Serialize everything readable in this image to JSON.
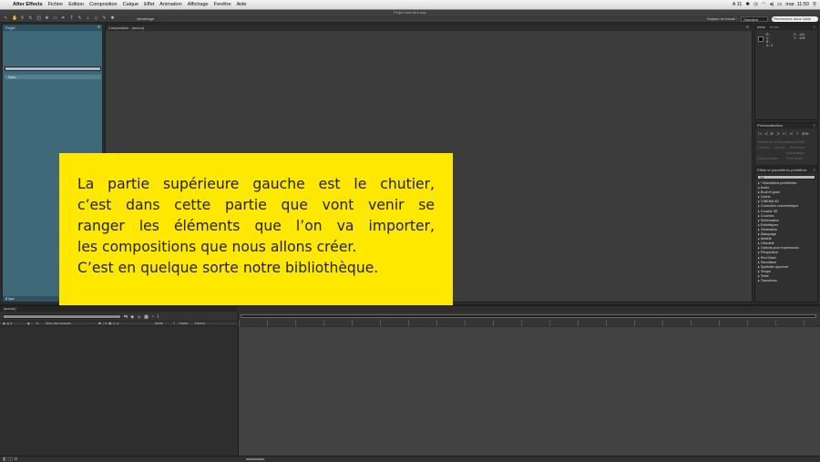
{
  "menubar": {
    "app_name": "After Effects",
    "items": [
      "Fichier",
      "Edition",
      "Composition",
      "Calque",
      "Effet",
      "Animation",
      "Affichage",
      "Fenêtre",
      "Aide"
    ],
    "status_label": "A 11",
    "clock": "mar. 11:50"
  },
  "window": {
    "title": "Projet sans titre.aep"
  },
  "toolbar": {
    "snap_label": "Aimantage",
    "workspace_label": "Espace de travail :",
    "workspace_value": "Standard",
    "search_placeholder": "Rechercher dans l'aide"
  },
  "project": {
    "tab": "Projet",
    "search_placeholder": "",
    "column_name": "Nom",
    "footer_label": "8 bpc"
  },
  "composition": {
    "tab_prefix": "Composition :",
    "tab_name": "(aucun)"
  },
  "info": {
    "tab": "Infos",
    "tab2": "Audio",
    "r": "R :",
    "g": "V :",
    "b": "B :",
    "a": "A : 0",
    "x": "X : -411",
    "y": "Y : -108"
  },
  "preview": {
    "tab": "Prévisualisation",
    "options_label": "Options de prévisualisation RAM",
    "framerate_label": "Cadence",
    "skip_label": "Ignorer",
    "resolution_label": "Résolution",
    "auto_value": "Automatique",
    "from_current": "Depuis instant",
    "fullscreen": "Plein écran"
  },
  "effects": {
    "tab": "Effets et paramètres prédéfinis",
    "items": [
      "* Animations prédéfinies",
      "Audio",
      "Bruit et grain",
      "Cache",
      "CINEMA 4D",
      "Correction colorimétrique",
      "Couche 3D",
      "Couches",
      "Déformation",
      "Esthétiques",
      "Génération",
      "Masquage",
      "Netteté",
      "Obsolète",
      "Options pour expressions",
      "Perspective",
      "Red Giant",
      "Simulation",
      "Synthetic Aperture",
      "Temps",
      "Texte",
      "Transitions"
    ]
  },
  "timeline": {
    "tab": "(aucun)",
    "timecode": "",
    "col_source": "Nom des sources",
    "col_mode": "Mode",
    "col_t": "T",
    "col_cache": "Cache",
    "col_parent": "Parent"
  },
  "caption": {
    "lines": [
      "La partie supérieure gauche est le chutier,",
      "c’est dans cette partie que vont venir se",
      "ranger les éléments que l’on va importer,",
      "les compositions que nous allons créer.",
      "C’est en quelque sorte notre bibliothèque."
    ]
  },
  "colors": {
    "caption_bg": "#ffe800",
    "project_bg": "#3f6978",
    "panel_bg": "#3c3c3c"
  }
}
